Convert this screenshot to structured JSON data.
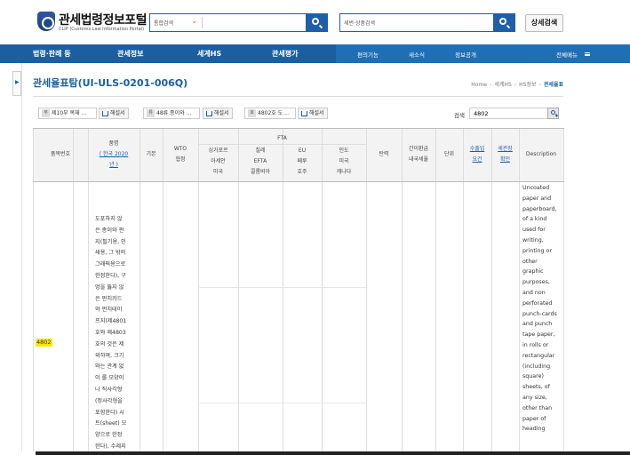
{
  "header": {
    "logo_title": "관세법령정보포털",
    "logo_subtitle": "CLIP (Customs Law Information Portal)",
    "search_category": "통합검색",
    "search_placeholder": "",
    "search2_category": "세번·상품검색",
    "search2_placeholder": "",
    "advanced_search_label": "상세검색"
  },
  "nav": {
    "main_items": [
      "법령·판례 등",
      "관세정보",
      "세계HS",
      "관세평가"
    ],
    "sub_items": [
      "편의기능",
      "새소식",
      "정보공개"
    ],
    "all_menu_label": "전체메뉴"
  },
  "page": {
    "title": "관세율표탐(UI-ULS-0201-006Q)",
    "breadcrumb": [
      "Home",
      "세계HS",
      "HS정보",
      "관세율표"
    ]
  },
  "filters": {
    "chips": [
      {
        "badge": "부",
        "label": "제10부 목재 ...",
        "download": "해설서"
      },
      {
        "badge": "류",
        "label": "48류 종이와 ...",
        "download": "해설서"
      },
      {
        "badge": "호",
        "label": "4802호 도 ...",
        "download": "해설서"
      }
    ],
    "search_label": "검색",
    "search_value": "4802"
  },
  "table": {
    "headers": {
      "hs_code": "품목번호",
      "name_line1": "품명",
      "name_line2": "( 한국  2020",
      "name_line3": "년 )",
      "basic": "기본",
      "wto_line1": "WTO",
      "wto_line2": "협정",
      "fta_title": "FTA",
      "fta_cols": [
        [
          "싱가포르",
          "아세안",
          "미국"
        ],
        [
          "칠레",
          "EFTA",
          "콜롬비아"
        ],
        [
          "EU",
          "페루",
          "호주"
        ],
        [
          "인도",
          "미국",
          "캐나다"
        ]
      ],
      "elastic": "탄력",
      "refund_line1": "간이환급",
      "refund_line2": "내국세율",
      "unit": "단위",
      "import_req_line1": "수출입",
      "import_req_line2": "요건",
      "customs_line1": "세관장",
      "customs_line2": "확인",
      "description": "Description"
    },
    "row": {
      "hs_code": "4802",
      "korean_lines": [
        "도포하지 않",
        "은 종이와 판",
        "지(필기용, 인",
        "쇄용, 그 밖의",
        "그래픽용으로",
        "한정한다), 구",
        "멍을 뚫지 않",
        "은 펀치카드",
        "와 펀치테이",
        "프지(제4801",
        "호와 제4803",
        "호의 것은 제",
        "외하며, 크기",
        "와는 관계 없",
        "이 롤 모양이",
        "나 직사각형",
        "(정사각형을",
        "포함한다) 시",
        "트(sheet) 모",
        "양으로 한정",
        "한다), 수제지"
      ],
      "description_lines": [
        "Uncoated",
        "paper and",
        "paperboard,",
        "of a kind",
        "used for",
        "writing,",
        "printing or",
        "other",
        "graphic",
        "purposes,",
        "and non",
        "perforated",
        "punch-cards",
        "and punch",
        "tape paper,",
        "in rolls or",
        "rectangular",
        "(including",
        "square)",
        "sheets, of",
        "any size,",
        "other than",
        "paper of",
        "heading"
      ]
    }
  }
}
